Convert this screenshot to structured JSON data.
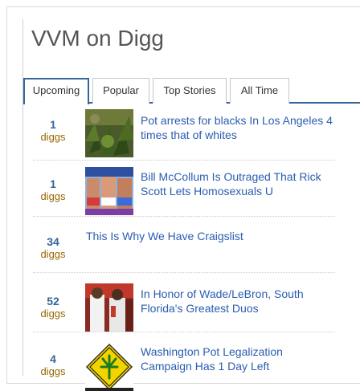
{
  "widget": {
    "title": "VVM on Digg",
    "tabs": [
      "Upcoming",
      "Popular",
      "Top Stories",
      "All Time"
    ],
    "active_tab": "Upcoming"
  },
  "stories": [
    {
      "diggs": "1",
      "diggs_label": "diggs",
      "title": "Pot arrests for blacks In Los Angeles 4 times that of whites",
      "thumb": "marijuana-plants-photo"
    },
    {
      "diggs": "1",
      "diggs_label": "diggs",
      "title": "Bill McCollum Is Outraged That Rick Scott Lets Homosexuals U",
      "thumb": "magazine-cover-photo"
    },
    {
      "diggs": "34",
      "diggs_label": "diggs",
      "title": "This Is Why We Have Craigslist",
      "thumb": ""
    },
    {
      "diggs": "52",
      "diggs_label": "diggs",
      "title": "In Honor of Wade/LeBron, South Florida's Greatest Duos",
      "thumb": "basketball-players-photo"
    },
    {
      "diggs": "4",
      "diggs_label": "diggs",
      "title": "Washington Pot Legalization Campaign Has 1 Day Left",
      "thumb": "legalize-sign-photo"
    }
  ],
  "colors": {
    "link": "#2a5db0",
    "count": "#336699",
    "diggs_label": "#996600",
    "tab_border": "#336699"
  }
}
